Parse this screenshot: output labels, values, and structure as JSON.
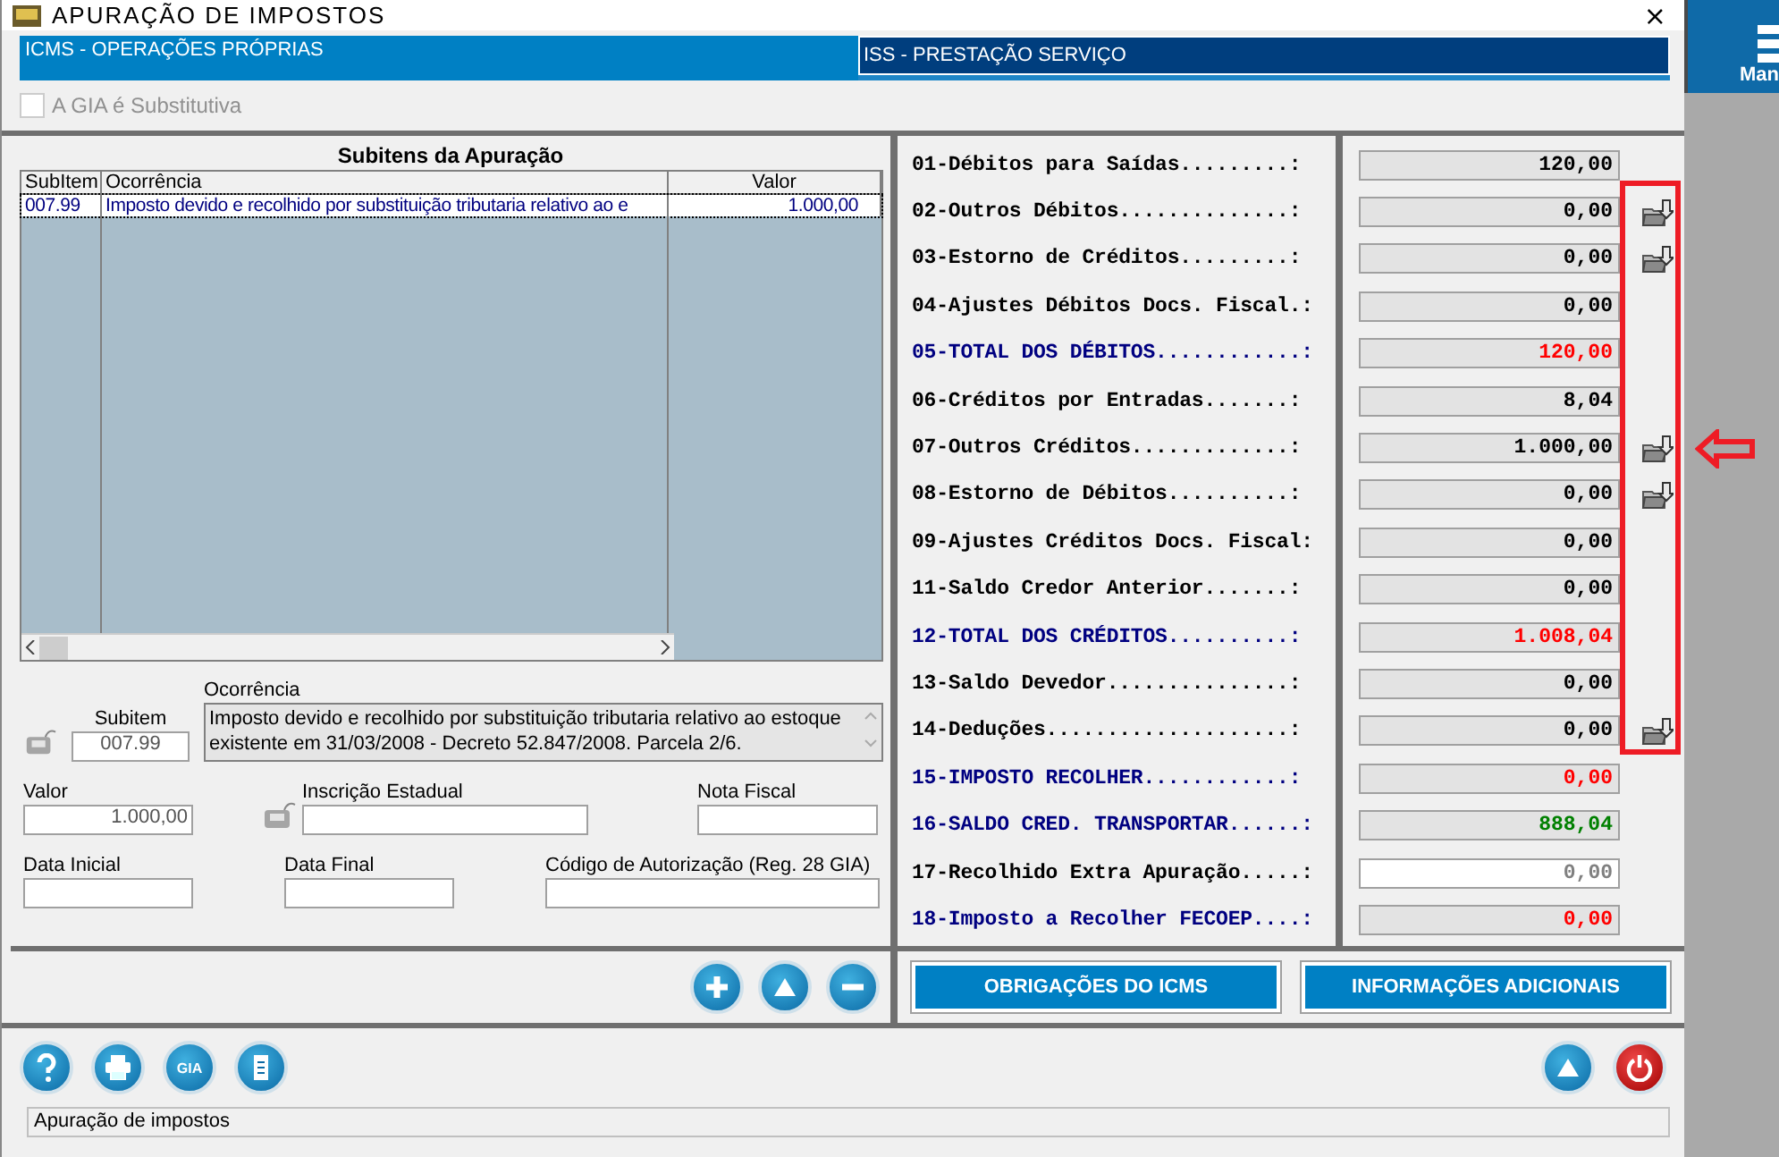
{
  "window": {
    "title": "APURAÇÃO DE IMPOSTOS",
    "close": "×"
  },
  "tabs": [
    {
      "label": "ICMS - OPERAÇÕES PRÓPRIAS",
      "selected": true
    },
    {
      "label": "ISS - PRESTAÇÃO SERVIÇO",
      "selected": false
    }
  ],
  "substitutive": {
    "label": "A GIA é Substitutiva",
    "checked": false,
    "disabled": true
  },
  "subitems": {
    "title": "Subitens da Apuração",
    "columns": [
      "SubItem",
      "Ocorrência",
      "Valor"
    ],
    "rows": [
      {
        "subitem": "007.99",
        "occurrence": "Imposto devido e recolhido por substituição tributaria relativo ao e",
        "value": "1.000,00",
        "selected": true
      }
    ]
  },
  "detail": {
    "subitem": {
      "label": "Subitem",
      "value": "007.99"
    },
    "occurrence": {
      "label": "Ocorrência",
      "value": "Imposto devido e recolhido por substituição tributaria relativo ao estoque existente em 31/03/2008 - Decreto 52.847/2008. Parcela 2/6."
    },
    "amount": {
      "label": "Valor",
      "value": "1.000,00"
    },
    "state_registration": {
      "label": "Inscrição Estadual"
    },
    "invoice": {
      "label": "Nota Fiscal"
    },
    "start_date": {
      "label": "Data Inicial"
    },
    "end_date": {
      "label": "Data Final"
    },
    "authorization_code": {
      "label": "Código de Autorização (Reg. 28 GIA)"
    }
  },
  "totals": [
    {
      "label": "01-Débitos para Saídas.........:",
      "value": "120,00",
      "kind": "line",
      "color": "#000000",
      "has_action": false,
      "editable": false
    },
    {
      "label": "02-Outros Débitos..............:",
      "value": "0,00",
      "kind": "line",
      "color": "#000000",
      "has_action": true,
      "editable": false
    },
    {
      "label": "03-Estorno de Créditos.........:",
      "value": "0,00",
      "kind": "line",
      "color": "#000000",
      "has_action": true,
      "editable": false
    },
    {
      "label": "04-Ajustes Débitos Docs. Fiscal.:",
      "value": "0,00",
      "kind": "line",
      "color": "#000000",
      "has_action": false,
      "editable": false
    },
    {
      "label": "05-TOTAL DOS DÉBITOS............:",
      "value": "120,00",
      "kind": "total",
      "color": "#ff0000",
      "has_action": false,
      "editable": false
    },
    {
      "label": "06-Créditos por Entradas.......:",
      "value": "8,04",
      "kind": "line",
      "color": "#000000",
      "has_action": false,
      "editable": false
    },
    {
      "label": "07-Outros Créditos.............:",
      "value": "1.000,00",
      "kind": "line",
      "color": "#000000",
      "has_action": true,
      "editable": false
    },
    {
      "label": "08-Estorno de Débitos..........:",
      "value": "0,00",
      "kind": "line",
      "color": "#000000",
      "has_action": true,
      "editable": false
    },
    {
      "label": "09-Ajustes Créditos Docs. Fiscal:",
      "value": "0,00",
      "kind": "line",
      "color": "#000000",
      "has_action": false,
      "editable": false
    },
    {
      "label": "11-Saldo Credor Anterior.......:",
      "value": "0,00",
      "kind": "line",
      "color": "#000000",
      "has_action": false,
      "editable": false
    },
    {
      "label": "12-TOTAL DOS CRÉDITOS..........:",
      "value": "1.008,04",
      "kind": "total",
      "color": "#ff0000",
      "has_action": false,
      "editable": false
    },
    {
      "label": "13-Saldo Devedor...............:",
      "value": "0,00",
      "kind": "line",
      "color": "#000000",
      "has_action": false,
      "editable": false
    },
    {
      "label": "14-Deduções....................:",
      "value": "0,00",
      "kind": "line",
      "color": "#000000",
      "has_action": true,
      "editable": false
    },
    {
      "label": "15-IMPOSTO RECOLHER............:",
      "value": "0,00",
      "kind": "total",
      "color": "#ff0000",
      "has_action": false,
      "editable": false
    },
    {
      "label": "16-SALDO CRED. TRANSPORTAR......:",
      "value": "888,04",
      "kind": "total",
      "color": "#008000",
      "has_action": false,
      "editable": false
    },
    {
      "label": "17-Recolhido Extra Apuração.....:",
      "value": "0,00",
      "kind": "line",
      "color": "#808080",
      "has_action": false,
      "editable": true
    },
    {
      "label": "18-Imposto a Recolher FECOEP....:",
      "value": "0,00",
      "kind": "total",
      "color": "#ff0000",
      "has_action": false,
      "editable": false
    }
  ],
  "actions": [
    "OBRIGAÇÕES DO ICMS",
    "INFORMAÇÕES ADICIONAIS"
  ],
  "toolbar": {
    "gia_label": "GIA"
  },
  "status_bar": "Apuração de impostos",
  "side_panel": {
    "label": "Man"
  }
}
